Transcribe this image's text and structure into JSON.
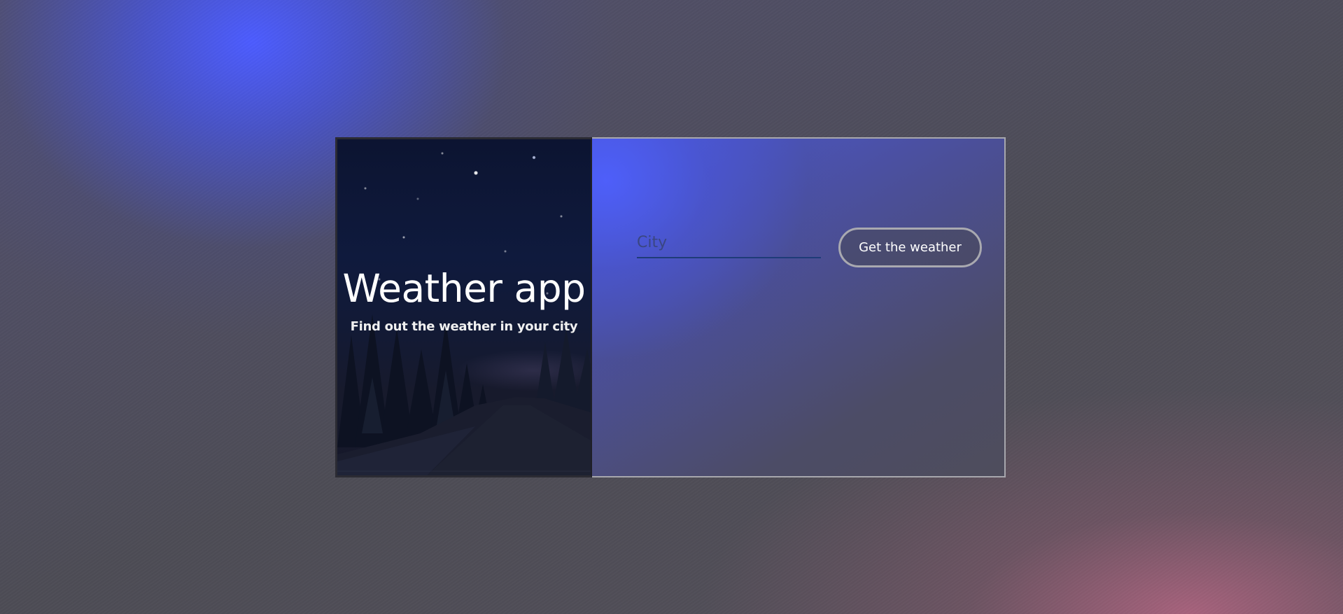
{
  "hero": {
    "title": "Weather app",
    "subtitle": "Find out the weather in your city"
  },
  "form": {
    "city_placeholder": "City",
    "city_value": "",
    "submit_label": "Get the weather"
  },
  "colors": {
    "accent_blue": "#4c5cff",
    "accent_pink": "#b06480",
    "background": "#4c4b52",
    "input_underline": "#1f3c78",
    "button_border": "#a9a9b0"
  }
}
